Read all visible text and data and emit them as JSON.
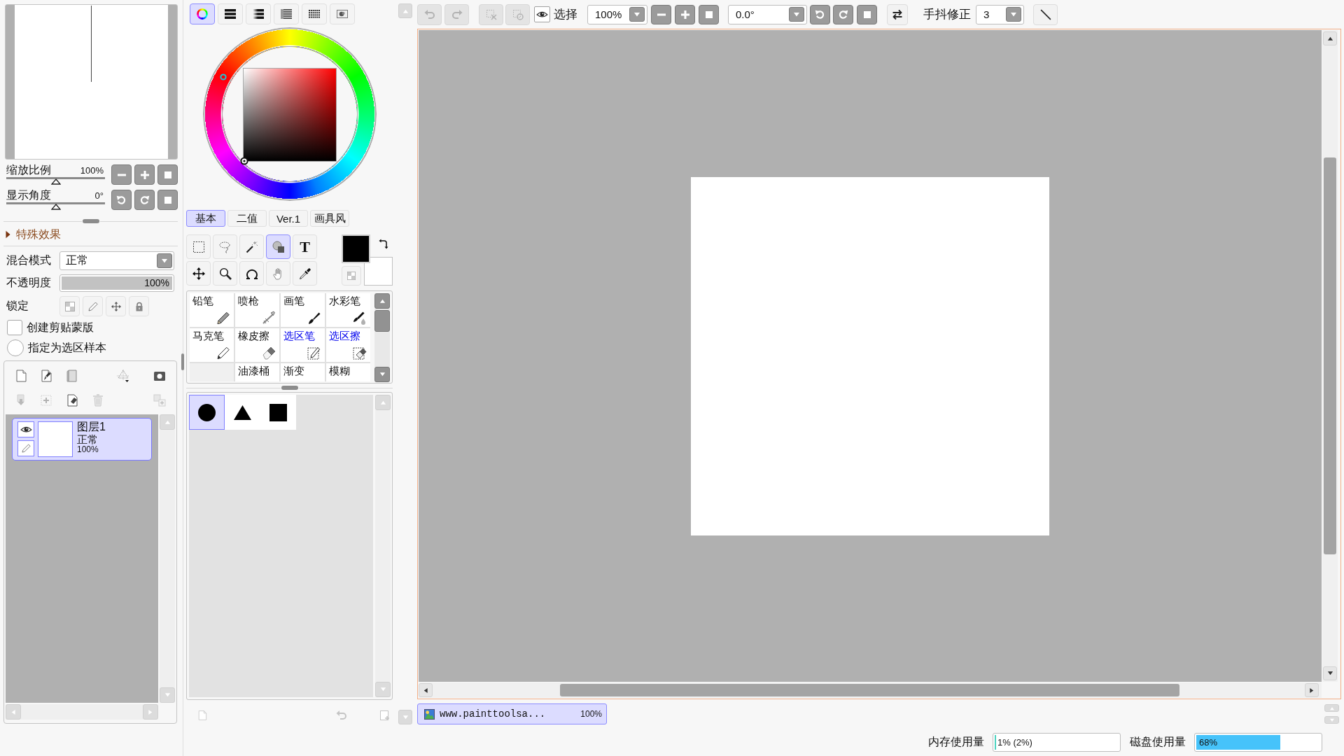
{
  "view": {
    "zoom": {
      "label": "缩放比例",
      "value": "100%",
      "level": 0.5
    },
    "angle": {
      "label": "显示角度",
      "value": "0°",
      "level": 0.5
    }
  },
  "effects": {
    "label": "特殊效果",
    "expanded": false
  },
  "layer_settings": {
    "blend_mode": {
      "label": "混合模式",
      "value": "正常"
    },
    "opacity": {
      "label": "不透明度",
      "value": "100%",
      "level": 1
    },
    "lock": {
      "label": "锁定",
      "items": [
        {
          "kind": "transparency",
          "on": false
        },
        {
          "kind": "paint",
          "on": false
        },
        {
          "kind": "move",
          "on": false
        },
        {
          "kind": "all",
          "on": false
        }
      ]
    },
    "options": [
      {
        "kind": "checkbox",
        "label": "创建剪贴蒙版",
        "checked": false
      },
      {
        "kind": "radio",
        "label": "指定为选区样本",
        "checked": false
      }
    ]
  },
  "layer_tools": [
    {
      "kind": "new",
      "disabled": false
    },
    {
      "kind": "vector",
      "disabled": false
    },
    {
      "kind": "folder",
      "disabled": false
    },
    {
      "kind": "perspective",
      "disabled": false
    },
    {
      "kind": "mask",
      "disabled": false
    },
    {
      "kind": "transfer",
      "disabled": true
    },
    {
      "kind": "add",
      "disabled": true
    },
    {
      "kind": "clear",
      "disabled": false
    },
    {
      "kind": "delete",
      "disabled": true
    },
    {
      "kind": "merge",
      "disabled": true
    }
  ],
  "layers": [
    {
      "name": "图层1",
      "mode": "正常",
      "opacity": "100%",
      "visible": true,
      "selected": true
    }
  ],
  "color_modes": [
    {
      "kind": "wheel",
      "selected": true
    },
    {
      "kind": "bars",
      "selected": false
    },
    {
      "kind": "gradient",
      "selected": false
    },
    {
      "kind": "list",
      "selected": false
    },
    {
      "kind": "grid",
      "selected": false
    },
    {
      "kind": "scratch",
      "selected": false
    }
  ],
  "color_tabs": [
    {
      "label": "基本",
      "selected": true
    },
    {
      "label": "二值",
      "selected": false
    },
    {
      "label": "Ver.1",
      "selected": false
    },
    {
      "label": "画具风",
      "selected": false
    }
  ],
  "color_swatches": [
    {
      "kind": "foreground",
      "color": "#000000"
    },
    {
      "kind": "background",
      "color": "#ffffff"
    }
  ],
  "tools": [
    {
      "kind": "marquee",
      "selected": false
    },
    {
      "kind": "lasso",
      "selected": false
    },
    {
      "kind": "wand",
      "selected": false
    },
    {
      "kind": "shapes",
      "selected": true
    },
    {
      "kind": "text",
      "label": "T",
      "selected": false
    },
    {
      "kind": "move",
      "selected": false
    },
    {
      "kind": "zoom",
      "selected": false
    },
    {
      "kind": "rotate",
      "selected": false
    },
    {
      "kind": "hand",
      "selected": false
    },
    {
      "kind": "eyedropper",
      "selected": false
    }
  ],
  "brushes": [
    {
      "kind": "pencil",
      "label": "铅笔"
    },
    {
      "kind": "airbrush",
      "label": "喷枪"
    },
    {
      "kind": "brush",
      "label": "画笔"
    },
    {
      "kind": "watercolor",
      "label": "水彩笔"
    },
    {
      "kind": "marker",
      "label": "马克笔"
    },
    {
      "kind": "eraser",
      "label": "橡皮擦"
    },
    {
      "kind": "selpen",
      "label": "选区笔"
    },
    {
      "kind": "selerase",
      "label": "选区擦"
    },
    {
      "kind": "empty"
    },
    {
      "kind": "bucket",
      "label": "油漆桶"
    },
    {
      "kind": "gradient",
      "label": "渐变"
    },
    {
      "kind": "blur",
      "label": "模糊"
    }
  ],
  "shapes": [
    {
      "kind": "circle",
      "selected": true
    },
    {
      "kind": "triangle",
      "selected": false
    },
    {
      "kind": "square",
      "selected": false
    }
  ],
  "toolbar": [
    {
      "kind": "undo",
      "disabled": true
    },
    {
      "kind": "redo",
      "disabled": true
    },
    {
      "kind": "deselect",
      "disabled": true
    },
    {
      "kind": "invert",
      "disabled": true
    },
    {
      "kind": "toggle",
      "label": "选择",
      "checked": true
    },
    {
      "kind": "zoom",
      "value": "100%"
    },
    {
      "kind": "zoomout"
    },
    {
      "kind": "zoomin"
    },
    {
      "kind": "reset"
    },
    {
      "kind": "angle",
      "value": "0.0°"
    },
    {
      "kind": "rotleft"
    },
    {
      "kind": "rotright"
    },
    {
      "kind": "reset"
    },
    {
      "kind": "flip"
    },
    {
      "kind": "label",
      "label": "手抖修正"
    },
    {
      "kind": "stabilizer",
      "value": "3"
    },
    {
      "kind": "straight"
    }
  ],
  "documents": [
    {
      "name": "www.painttoolsa...",
      "zoom": "100%",
      "selected": true
    }
  ],
  "status_bar": {
    "memory": {
      "label": "内存使用量",
      "value": "1% (2%)",
      "level": 0.01
    },
    "disk": {
      "label": "磁盘使用量",
      "value": "68%",
      "level": 0.68
    }
  }
}
